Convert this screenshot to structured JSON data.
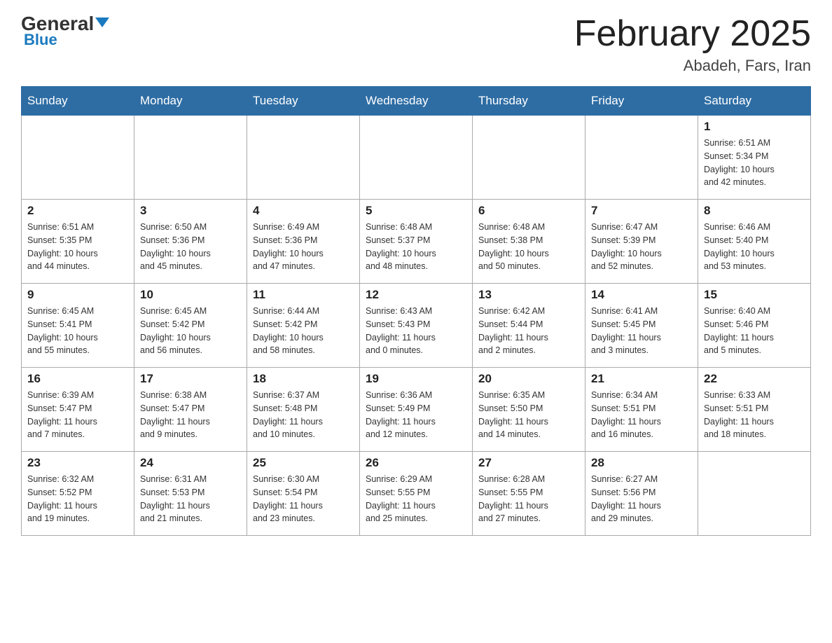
{
  "logo": {
    "general": "General",
    "blue": "Blue",
    "triangle": "▼"
  },
  "title": "February 2025",
  "subtitle": "Abadeh, Fars, Iran",
  "weekdays": [
    "Sunday",
    "Monday",
    "Tuesday",
    "Wednesday",
    "Thursday",
    "Friday",
    "Saturday"
  ],
  "weeks": [
    [
      {
        "day": "",
        "info": ""
      },
      {
        "day": "",
        "info": ""
      },
      {
        "day": "",
        "info": ""
      },
      {
        "day": "",
        "info": ""
      },
      {
        "day": "",
        "info": ""
      },
      {
        "day": "",
        "info": ""
      },
      {
        "day": "1",
        "info": "Sunrise: 6:51 AM\nSunset: 5:34 PM\nDaylight: 10 hours\nand 42 minutes."
      }
    ],
    [
      {
        "day": "2",
        "info": "Sunrise: 6:51 AM\nSunset: 5:35 PM\nDaylight: 10 hours\nand 44 minutes."
      },
      {
        "day": "3",
        "info": "Sunrise: 6:50 AM\nSunset: 5:36 PM\nDaylight: 10 hours\nand 45 minutes."
      },
      {
        "day": "4",
        "info": "Sunrise: 6:49 AM\nSunset: 5:36 PM\nDaylight: 10 hours\nand 47 minutes."
      },
      {
        "day": "5",
        "info": "Sunrise: 6:48 AM\nSunset: 5:37 PM\nDaylight: 10 hours\nand 48 minutes."
      },
      {
        "day": "6",
        "info": "Sunrise: 6:48 AM\nSunset: 5:38 PM\nDaylight: 10 hours\nand 50 minutes."
      },
      {
        "day": "7",
        "info": "Sunrise: 6:47 AM\nSunset: 5:39 PM\nDaylight: 10 hours\nand 52 minutes."
      },
      {
        "day": "8",
        "info": "Sunrise: 6:46 AM\nSunset: 5:40 PM\nDaylight: 10 hours\nand 53 minutes."
      }
    ],
    [
      {
        "day": "9",
        "info": "Sunrise: 6:45 AM\nSunset: 5:41 PM\nDaylight: 10 hours\nand 55 minutes."
      },
      {
        "day": "10",
        "info": "Sunrise: 6:45 AM\nSunset: 5:42 PM\nDaylight: 10 hours\nand 56 minutes."
      },
      {
        "day": "11",
        "info": "Sunrise: 6:44 AM\nSunset: 5:42 PM\nDaylight: 10 hours\nand 58 minutes."
      },
      {
        "day": "12",
        "info": "Sunrise: 6:43 AM\nSunset: 5:43 PM\nDaylight: 11 hours\nand 0 minutes."
      },
      {
        "day": "13",
        "info": "Sunrise: 6:42 AM\nSunset: 5:44 PM\nDaylight: 11 hours\nand 2 minutes."
      },
      {
        "day": "14",
        "info": "Sunrise: 6:41 AM\nSunset: 5:45 PM\nDaylight: 11 hours\nand 3 minutes."
      },
      {
        "day": "15",
        "info": "Sunrise: 6:40 AM\nSunset: 5:46 PM\nDaylight: 11 hours\nand 5 minutes."
      }
    ],
    [
      {
        "day": "16",
        "info": "Sunrise: 6:39 AM\nSunset: 5:47 PM\nDaylight: 11 hours\nand 7 minutes."
      },
      {
        "day": "17",
        "info": "Sunrise: 6:38 AM\nSunset: 5:47 PM\nDaylight: 11 hours\nand 9 minutes."
      },
      {
        "day": "18",
        "info": "Sunrise: 6:37 AM\nSunset: 5:48 PM\nDaylight: 11 hours\nand 10 minutes."
      },
      {
        "day": "19",
        "info": "Sunrise: 6:36 AM\nSunset: 5:49 PM\nDaylight: 11 hours\nand 12 minutes."
      },
      {
        "day": "20",
        "info": "Sunrise: 6:35 AM\nSunset: 5:50 PM\nDaylight: 11 hours\nand 14 minutes."
      },
      {
        "day": "21",
        "info": "Sunrise: 6:34 AM\nSunset: 5:51 PM\nDaylight: 11 hours\nand 16 minutes."
      },
      {
        "day": "22",
        "info": "Sunrise: 6:33 AM\nSunset: 5:51 PM\nDaylight: 11 hours\nand 18 minutes."
      }
    ],
    [
      {
        "day": "23",
        "info": "Sunrise: 6:32 AM\nSunset: 5:52 PM\nDaylight: 11 hours\nand 19 minutes."
      },
      {
        "day": "24",
        "info": "Sunrise: 6:31 AM\nSunset: 5:53 PM\nDaylight: 11 hours\nand 21 minutes."
      },
      {
        "day": "25",
        "info": "Sunrise: 6:30 AM\nSunset: 5:54 PM\nDaylight: 11 hours\nand 23 minutes."
      },
      {
        "day": "26",
        "info": "Sunrise: 6:29 AM\nSunset: 5:55 PM\nDaylight: 11 hours\nand 25 minutes."
      },
      {
        "day": "27",
        "info": "Sunrise: 6:28 AM\nSunset: 5:55 PM\nDaylight: 11 hours\nand 27 minutes."
      },
      {
        "day": "28",
        "info": "Sunrise: 6:27 AM\nSunset: 5:56 PM\nDaylight: 11 hours\nand 29 minutes."
      },
      {
        "day": "",
        "info": ""
      }
    ]
  ]
}
